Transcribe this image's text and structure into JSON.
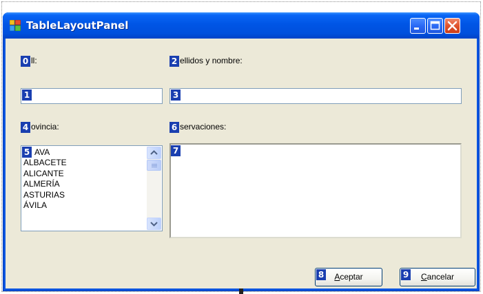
{
  "window": {
    "title": "TableLayoutPanel",
    "colors": {
      "titlebar": "#0055e5",
      "client": "#ece9d8",
      "label_badge": "#1a3fb0",
      "close": "#e0532d"
    }
  },
  "badges": [
    "0",
    "1",
    "2",
    "3",
    "4",
    "5",
    "6",
    "7",
    "8",
    "9"
  ],
  "labels": {
    "nif": "ll:",
    "apellidos": "ellidos y nombre:",
    "provincia": "ovincia:",
    "observaciones": "servaciones:"
  },
  "fields": {
    "nif_value": "",
    "apellidos_value": "",
    "observaciones_value": ""
  },
  "provinces": {
    "items": [
      "AVA",
      "ALBACETE",
      "ALICANTE",
      "ALMERÍA",
      "ASTURIAS",
      "ÁVILA"
    ]
  },
  "buttons": {
    "accept_mnemonic": "A",
    "accept_rest": "ceptar",
    "cancel_mnemonic": "C",
    "cancel_rest": "ancelar"
  },
  "icons": [
    "app-icon",
    "minimize-icon",
    "maximize-icon",
    "close-icon",
    "scroll-up-icon",
    "scroll-down-icon"
  ]
}
